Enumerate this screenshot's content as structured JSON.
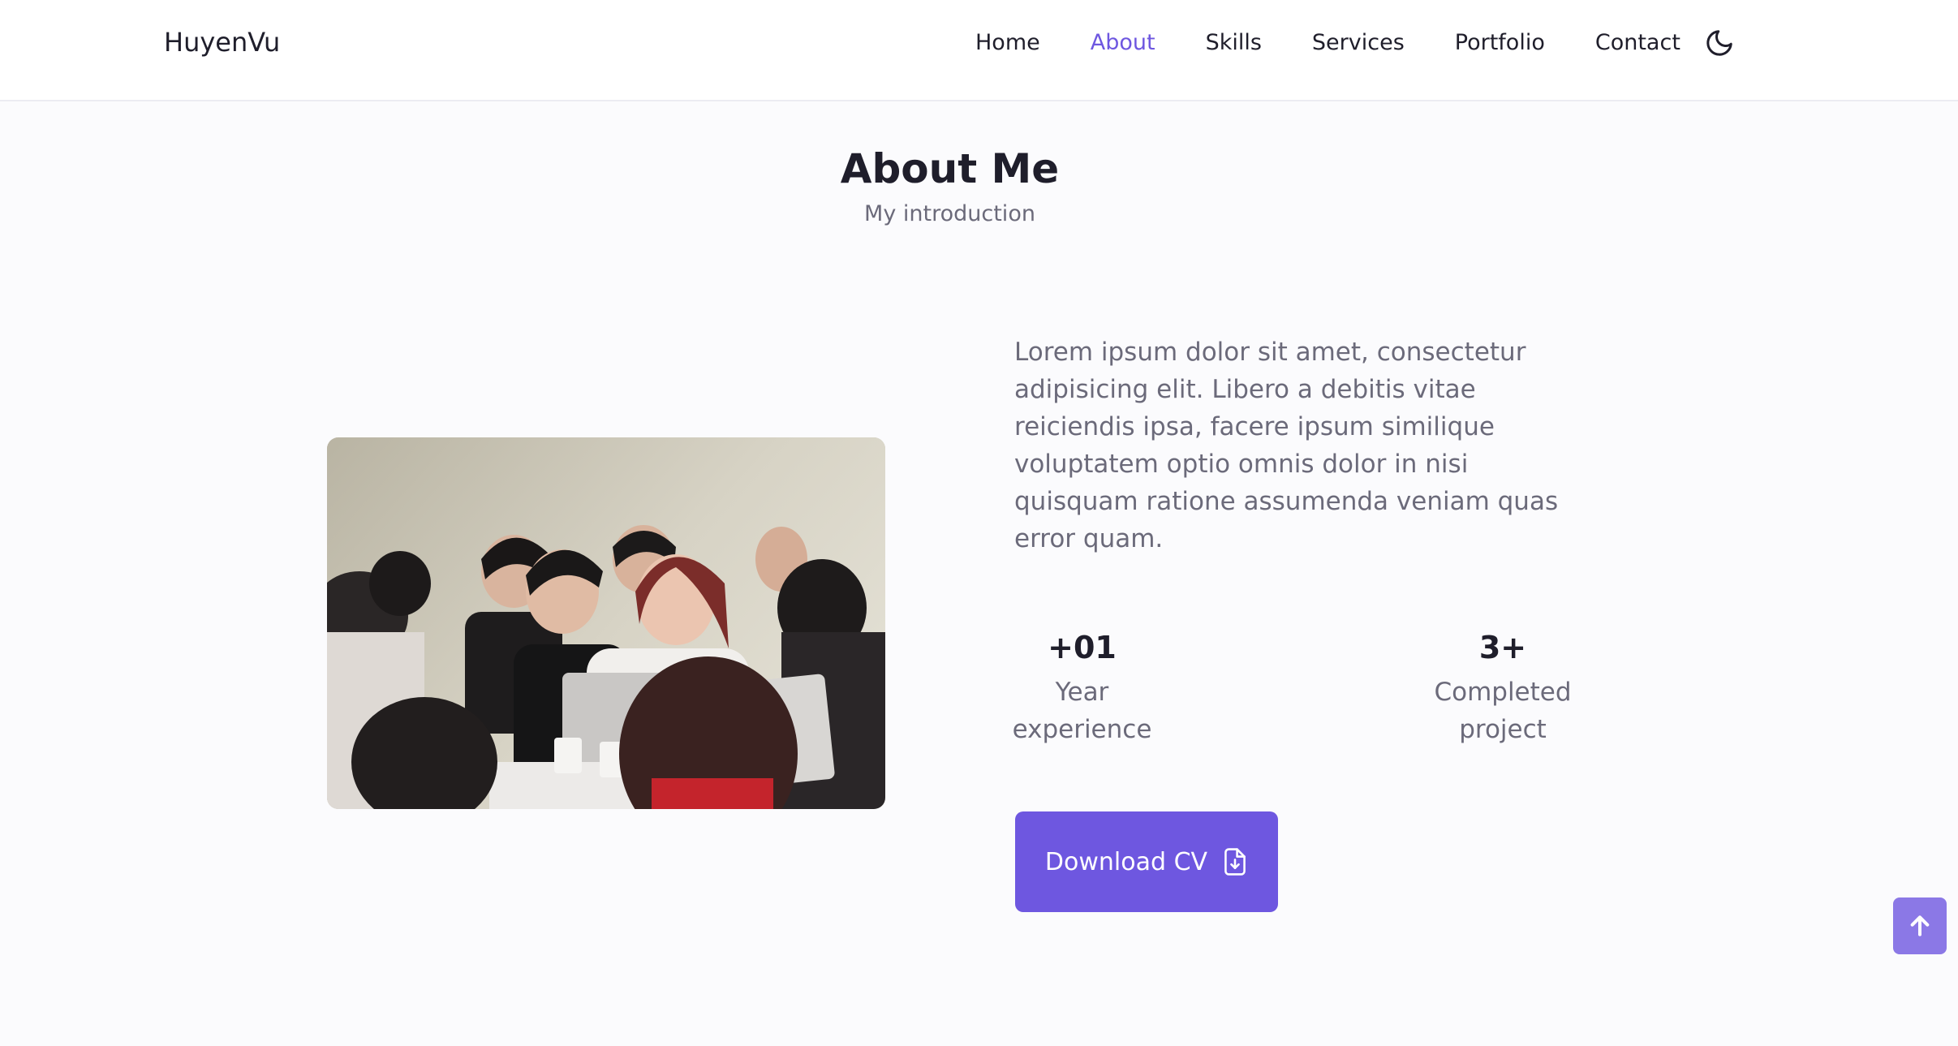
{
  "header": {
    "logo": "HuyenVu",
    "nav": [
      {
        "label": "Home",
        "active": false
      },
      {
        "label": "About",
        "active": true
      },
      {
        "label": "Skills",
        "active": false
      },
      {
        "label": "Services",
        "active": false
      },
      {
        "label": "Portfolio",
        "active": false
      },
      {
        "label": "Contact",
        "active": false
      }
    ],
    "theme_icon": "moon-icon"
  },
  "about": {
    "title": "About Me",
    "subtitle": "My introduction",
    "description": "Lorem ipsum dolor sit amet, consectetur adipisicing elit. Libero a debitis vitae reiciendis ipsa, facere ipsum similique voluptatem optio omnis dolor in nisi quisquam ratione assumenda veniam quas error quam.",
    "stats": [
      {
        "value": "+01",
        "label_line1": "Year",
        "label_line2": "experience"
      },
      {
        "value": "3+",
        "label_line1": "Completed",
        "label_line2": "project"
      }
    ],
    "download_label": "Download CV",
    "download_icon": "file-download-icon"
  },
  "scroll_up_icon": "arrow-up-icon",
  "colors": {
    "accent": "#6e57e0",
    "text": "#1f1e2b",
    "muted": "#6b6a7a",
    "background": "#fbfbfd"
  }
}
